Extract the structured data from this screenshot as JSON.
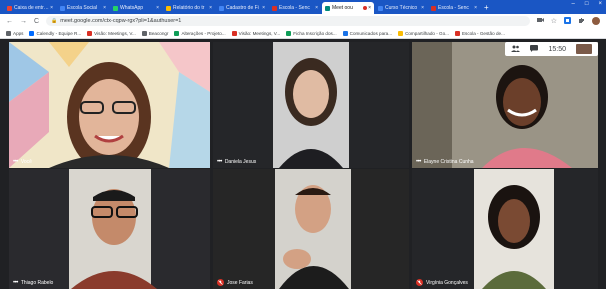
{
  "browser": {
    "tabs": [
      {
        "title": "Caixa de entrada",
        "favicon_color": "#ea4335",
        "active": false
      },
      {
        "title": "Escola Social",
        "favicon_color": "#4285f4",
        "active": false
      },
      {
        "title": "WhatsApp",
        "favicon_color": "#25d366",
        "active": false
      },
      {
        "title": "Relatório do tr",
        "favicon_color": "#fbbc04",
        "active": false
      },
      {
        "title": "Cadastro de Fi",
        "favicon_color": "#4285f4",
        "active": false
      },
      {
        "title": "Escola - Senc",
        "favicon_color": "#d93025",
        "active": false
      },
      {
        "title": "Meet oou",
        "favicon_color": "#00897b",
        "active": true,
        "recording": true
      },
      {
        "title": "Curso Técnico",
        "favicon_color": "#4285f4",
        "active": false
      },
      {
        "title": "Escola - Senc",
        "favicon_color": "#d93025",
        "active": false
      }
    ],
    "new_tab": "+",
    "window_controls": {
      "minimize": "–",
      "maximize": "□",
      "close": "×"
    },
    "address": {
      "back": "←",
      "forward": "→",
      "reload": "C",
      "lock": "🔒",
      "url": "meet.google.com/ctx-cqpw-rgx?pli=1&authuser=1",
      "star": "☆"
    },
    "bookmarks": [
      {
        "label": "Apps",
        "color": "#5f6368"
      },
      {
        "label": "Calendly - Equipe R...",
        "color": "#006bff"
      },
      {
        "label": "Visão: Meetings, V...",
        "color": "#d93025"
      },
      {
        "label": "Beacongr",
        "color": "#5f6368"
      },
      {
        "label": "Alterações - Projeto...",
        "color": "#0f9d58"
      },
      {
        "label": "Visão: Meetings, V...",
        "color": "#d93025"
      },
      {
        "label": "Ficha Inscrição dos...",
        "color": "#0f9d58"
      },
      {
        "label": "Comunicados para...",
        "color": "#1a73e8"
      },
      {
        "label": "Compartilhado - Go...",
        "color": "#fbbc04"
      },
      {
        "label": "Escola - Gestão de...",
        "color": "#d93025"
      }
    ]
  },
  "meet": {
    "time": "15:50",
    "participants": [
      {
        "name": "Você",
        "muted": false
      },
      {
        "name": "Daniela Jesus",
        "muted": false
      },
      {
        "name": "Elayne Cristina Cunha",
        "muted": false
      },
      {
        "name": "Thiago Rabelo",
        "muted": false
      },
      {
        "name": "Jose Farias",
        "muted": true
      },
      {
        "name": "Virgínia Gonçalves",
        "muted": true
      }
    ]
  }
}
